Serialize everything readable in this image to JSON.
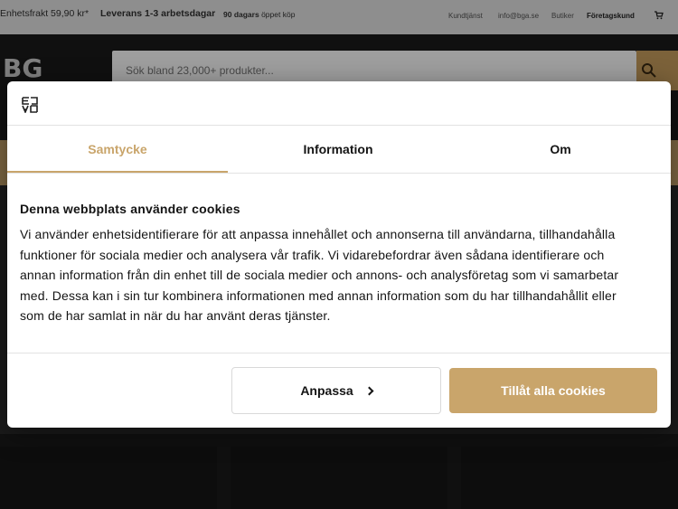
{
  "topbar": {
    "shipping": "Enhetsfrakt 59,90 kr*",
    "delivery": "Leverans 1-3 arbetsdagar",
    "returns_bold": "90 dagars",
    "returns_rest": "öppet köp",
    "links": {
      "support": "Kundtjänst",
      "email": "info@bga.se",
      "stores": "Butiker",
      "business": "Företagskund"
    }
  },
  "search": {
    "placeholder": "Sök bland 23,000+ produkter..."
  },
  "dialog": {
    "tabs": [
      {
        "label": "Samtycke",
        "active": true
      },
      {
        "label": "Information",
        "active": false
      },
      {
        "label": "Om",
        "active": false
      }
    ],
    "title": "Denna webbplats använder cookies",
    "lines": [
      "Vi använder enhetsidentifierare för att anpassa innehållet och annonserna till användarna, tillhandahålla",
      "funktioner för sociala medier och analysera vår trafik. Vi vidarebefordrar även sådana identifierare och",
      "annan information från din enhet till de sociala medier och annons- och analysföretag som vi samarbetar",
      "med. Dessa kan i sin tur kombinera informationen med annan information som du har tillhandahållit eller",
      "som de har samlat in när du har använt deras tjänster."
    ],
    "customize_label": "Anpassa",
    "allow_all_label": "Tillåt alla cookies"
  },
  "colors": {
    "accent": "#c9a56b",
    "header_bg": "#1b1b1b",
    "topbar_bg": "#e5e5e5"
  }
}
